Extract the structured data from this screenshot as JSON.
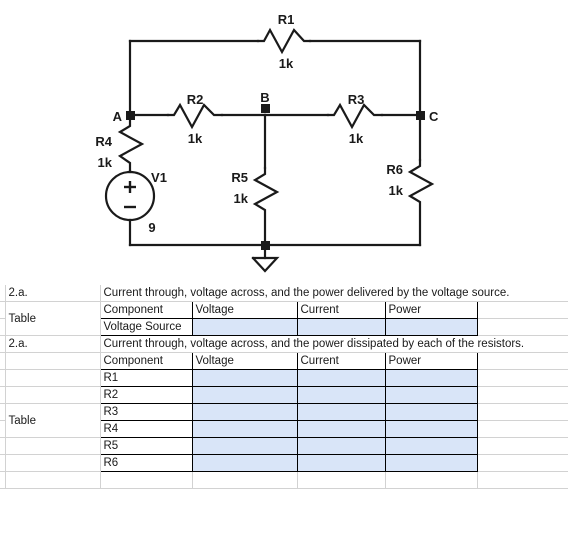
{
  "circuit": {
    "title": "resistor-network-schematic",
    "nodes": [
      {
        "name": "A",
        "label": "A"
      },
      {
        "name": "B",
        "label": "B"
      },
      {
        "name": "C",
        "label": "C"
      }
    ],
    "components": [
      {
        "ref": "R1",
        "value": "1k",
        "orientation": "horizontal"
      },
      {
        "ref": "R2",
        "value": "1k",
        "orientation": "horizontal"
      },
      {
        "ref": "R3",
        "value": "1k",
        "orientation": "horizontal"
      },
      {
        "ref": "R4",
        "value": "1k",
        "orientation": "vertical"
      },
      {
        "ref": "R5",
        "value": "1k",
        "orientation": "vertical"
      },
      {
        "ref": "R6",
        "value": "1k",
        "orientation": "vertical"
      },
      {
        "ref": "V1",
        "value": "9",
        "orientation": "vertical",
        "plus": "+",
        "minus": "−"
      }
    ],
    "ground": "ground-symbol"
  },
  "sheet": {
    "section1": {
      "index_label": "2.a.",
      "prompt": "Current through, voltage across, and the power delivered by the voltage source.",
      "type_label": "Table",
      "headers": [
        "Component",
        "Voltage",
        "Current",
        "Power"
      ],
      "rows": [
        {
          "component": "Voltage Source",
          "voltage": "",
          "current": "",
          "power": ""
        }
      ]
    },
    "section2": {
      "index_label": "2.a.",
      "prompt": "Current through, voltage across, and the power dissipated by each of the resistors.",
      "type_label": "Table",
      "headers": [
        "Component",
        "Voltage",
        "Current",
        "Power"
      ],
      "rows": [
        {
          "component": "R1",
          "voltage": "",
          "current": "",
          "power": ""
        },
        {
          "component": "R2",
          "voltage": "",
          "current": "",
          "power": ""
        },
        {
          "component": "R3",
          "voltage": "",
          "current": "",
          "power": ""
        },
        {
          "component": "R4",
          "voltage": "",
          "current": "",
          "power": ""
        },
        {
          "component": "R5",
          "voltage": "",
          "current": "",
          "power": ""
        },
        {
          "component": "R6",
          "voltage": "",
          "current": "",
          "power": ""
        }
      ]
    },
    "colors": {
      "input_cell_fill": "#d9e5f8",
      "grid_line": "#d2d2d2",
      "table_border": "#000000",
      "text": "#1a1a1a"
    }
  }
}
